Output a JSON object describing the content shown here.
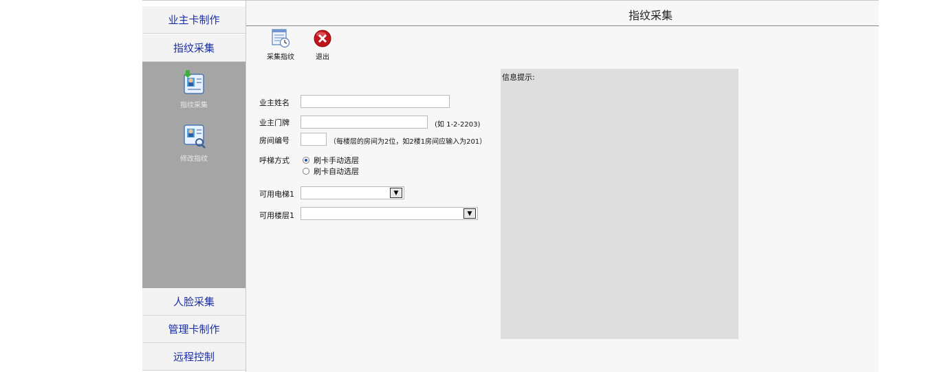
{
  "sidebar": {
    "top_items": [
      {
        "label": "业主卡制作"
      },
      {
        "label": "指纹采集"
      }
    ],
    "panel_items": [
      {
        "label": "指纹采集",
        "icon": "fingerprint-collect-icon"
      },
      {
        "label": "修改指纹",
        "icon": "fingerprint-edit-icon"
      }
    ],
    "bottom_items": [
      {
        "label": "人脸采集"
      },
      {
        "label": "管理卡制作"
      },
      {
        "label": "远程控制"
      }
    ]
  },
  "main": {
    "title": "指纹采集",
    "toolbar": {
      "collect_label": "采集指纹",
      "exit_label": "退出"
    },
    "form": {
      "owner_name_label": "业主姓名",
      "owner_name_value": "",
      "door_label": "业主门牌",
      "door_value": "",
      "door_hint": "(如 1-2-2203)",
      "room_label": "房间编号",
      "room_value": "",
      "room_hint": "（每楼层的房间为2位，如2楼1房间应输入为201）",
      "call_label": "呼梯方式",
      "call_options": [
        {
          "label": "刷卡手动选层",
          "selected": true
        },
        {
          "label": "刷卡自动选层",
          "selected": false
        }
      ],
      "elevator_label": "可用电梯1",
      "elevator_value": "",
      "floor_label": "可用楼层1",
      "floor_value": ""
    },
    "info": {
      "title": "信息提示:"
    }
  },
  "colors": {
    "nav_text": "#1a2fa8",
    "panel_bg": "#a5a5a5",
    "info_bg": "#dedede"
  }
}
